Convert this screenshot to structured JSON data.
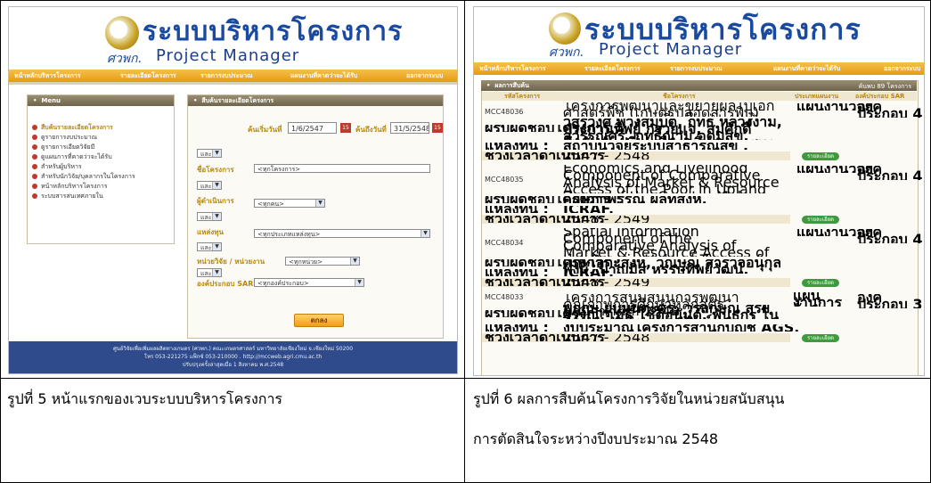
{
  "captions": {
    "left": "รูปที่ 5 หน้าแรกของเวบระบบบริหารโครงการ",
    "right_line1": "รูปที่ 6 ผลการสืบค้นโครงการวิจัยในหน่วยสนับสนุน",
    "right_line2": "การตัดสินใจระหว่างปีงบประมาณ 2548"
  },
  "brand": {
    "title_th": "ระบบบริหารโครงการ",
    "sub_th": "ศวพก.",
    "title_en": "Project Manager"
  },
  "nav": [
    "หน้าหลักบริหารโครงการ",
    "รายละเอียดโครงการ",
    "รายการงบประมาณ",
    "แผนงานที่คาดว่าจะได้รับ",
    "ออกจากระบบ"
  ],
  "left_screen": {
    "menu_title": "Menu",
    "menu_items": [
      "สืบค้นรายละเอียดโครงการ",
      "ดูรายการงบประมาณ",
      "ดูรายการเอียดวิจัยมี",
      "ดูแผนการที่คาดว่าจะได้รับ",
      "สำหรับผู้บริหาร",
      "สำหรับนักวิจัย/บุคลากรในโครงการ",
      "หน้าหลักบริหารโครงการ",
      "ระบบสารสนเทศภายใน"
    ],
    "search_title": "สืบค้นรายละเอียดโครงการ",
    "start_date_label": "ค้นเริ่มวันที่",
    "start_date_value": "1/6/2547",
    "end_date_label": "ค้นถึงวันที่",
    "end_date_value": "31/5/2548",
    "op_value": "และ",
    "project_name_label": "ชื่อโครงการ",
    "project_name_value": "<ทุกโครงการ>",
    "researcher_label": "ผู้ดำเนินการ",
    "researcher_value": "<ทุกคน>",
    "fund_label": "แหล่งทุน",
    "fund_value": "<ทุกประเภทแหล่งทุน>",
    "unit_label": "หน่วยวิจัย / หน่วยงาน",
    "unit_value": "<ทุกหน่วย>",
    "sar_label": "องค์ประกอบ SAR",
    "sar_value": "<ทุกองค์ประกอบ>",
    "submit_label": "ตกลง",
    "footer_lines": [
      "ศูนย์วิจัยเพื่อเพิ่มผลผลิตทางเกษตร (ศวพก.) คณะเกษตรศาสตร์ มหาวิทยาลัยเชียงใหม่ จ.เชียงใหม่ 50200",
      "โทร 053-221275 แฟ็กซ์ 053-210000 . http://mccweb.agri.cmu.ac.th",
      "ปรับปรุงครั้งล่าสุดเมื่อ 1 สิงหาคม พ.ศ.2548"
    ]
  },
  "right_screen": {
    "results_title": "ผลการสืบค้น",
    "count_text": "ค้นพบ 89 โครงการ",
    "columns": [
      "รหัสโครงการ",
      "ชื่อโครงการ",
      "ประเภทแผนงาน",
      "องค์ประกอบ SAR"
    ],
    "labels": {
      "leader": "ผู้รับผิดชอบโครงการ :",
      "fund": "แหล่งทุน :",
      "period": "ช่วงเวลาดำเนินการ",
      "detail": "รายละเอียด"
    },
    "projects": [
      {
        "code": "MCC48036",
        "title": "โครงการพัฒนาและขยายผลไปเอกศาสตร์พืช (เกษตรปลอดสารพิษ) แผนงานอาหารเชียงใหม่ปลอดภัย",
        "type": "แผนงานวิจัย",
        "sar": "องค์ประกอบ 4",
        "leader": "วสุรวงศ์ พวงสมบัติ, ฤทธิ หลวงงาม, ประกานทิพย์ กรวยแจ, สมศักดิ์ สุวรรณศรี, ฤทธิ์ณาม อุดมสุข, สัมพันธ์ เปลี่ยนเรือง, พิเชฐ ตนุสุนร",
        "fund": "สถาบันวิจัยระบบสาธารณสุข .",
        "period": "2547 - 2548"
      },
      {
        "code": "MCC48035",
        "title": "Economics and Livelihood Component of Comparative Analysis of Market & Resource Access of the Poor in Upland Zones of the Greater Mekong Region Project",
        "type": "แผนงานวิจัย",
        "sar": "องค์ประกอบ 4",
        "leader": "กฤษฎาพรรณ์ ผลทสิงห์,",
        "fund": "ICRAF.",
        "period": "2548 - 2549"
      },
      {
        "code": "MCC48034",
        "title": "Spatial Information Component of the Comparative Analysis of Market & Resource Access of the Poor in Upland Zones of the Greater Mekong Region Project",
        "type": "แผนงานวิจัย",
        "sar": "องค์ประกอบ 4",
        "leader": "เมธี เอกะสิงห์, วณิษณ์ สำรวจอนุกุลพงษ์, บาญมิส หรรษทิพย์วัฒน์,",
        "fund": "ICRAF.",
        "period": "2548 - 2549"
      },
      {
        "code": "MCC48033",
        "title": "โครงการสนับสนุนการพัฒนาคุณภาพการศึกษาหลักสูตรนานาชาติ ปี 2548",
        "type": "แผนงานการจัดการศึกษา",
        "sar": "องค์ประกอบ 3",
        "leader": "พฤกษ์ ยิบมันตะศิริ, วรลักษณ์ สุริยวรรณ, เมธี โชติอนันต์, พันธกร โนวินทร, สมจิต ถาวรวัฒน์",
        "fund": "งบประมาณโครงการสำนักบัญชี AGS.",
        "period": "2547 - 2548"
      }
    ]
  }
}
